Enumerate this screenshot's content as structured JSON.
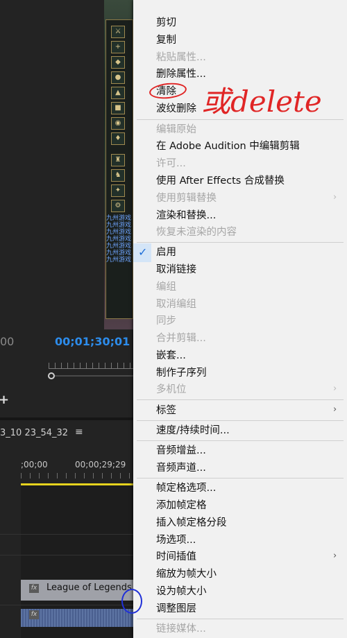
{
  "preview": {
    "timecode_left": "00",
    "timecode_current": "00;01;30;01",
    "game_texts": [
      "九州游戏",
      "九州游戏",
      "九州游戏",
      "九州游戏",
      "九州游戏",
      "九州游戏",
      "九州游戏"
    ]
  },
  "timeline": {
    "sequence_name": "3_10 23_54_32",
    "menu_icon": "≡",
    "time_start": ";00;00",
    "time_mark": "00;00;29;29",
    "clip_video_label": "League of Legends",
    "fx_label": "fx",
    "playhead_color": "#e6d31e",
    "clip_audio_color": "#5d74a3"
  },
  "context_menu": {
    "items": [
      {
        "label": "剪切",
        "enabled": true
      },
      {
        "label": "复制",
        "enabled": true
      },
      {
        "label": "粘贴属性...",
        "enabled": false
      },
      {
        "label": "删除属性...",
        "enabled": true
      },
      {
        "label": "清除",
        "enabled": true
      },
      {
        "label": "波纹删除",
        "enabled": true
      },
      {
        "label": "编辑原始",
        "enabled": false
      },
      {
        "label": "在 Adobe Audition 中编辑剪辑",
        "enabled": true
      },
      {
        "label": "许可...",
        "enabled": false
      },
      {
        "label": "使用 After Effects 合成替换",
        "enabled": true
      },
      {
        "label": "使用剪辑替换",
        "enabled": false,
        "submenu": true
      },
      {
        "label": "渲染和替换...",
        "enabled": true
      },
      {
        "label": "恢复未渲染的内容",
        "enabled": false
      },
      {
        "label": "启用",
        "enabled": true,
        "checked": true
      },
      {
        "label": "取消链接",
        "enabled": true
      },
      {
        "label": "编组",
        "enabled": false
      },
      {
        "label": "取消编组",
        "enabled": false
      },
      {
        "label": "同步",
        "enabled": false
      },
      {
        "label": "合并剪辑...",
        "enabled": false
      },
      {
        "label": "嵌套...",
        "enabled": true
      },
      {
        "label": "制作子序列",
        "enabled": true
      },
      {
        "label": "多机位",
        "enabled": false,
        "submenu": true
      },
      {
        "label": "标签",
        "enabled": true,
        "submenu": true
      },
      {
        "label": "速度/持续时间...",
        "enabled": true
      },
      {
        "label": "音频增益...",
        "enabled": true
      },
      {
        "label": "音频声道...",
        "enabled": true
      },
      {
        "label": "帧定格选项...",
        "enabled": true
      },
      {
        "label": "添加帧定格",
        "enabled": true
      },
      {
        "label": "插入帧定格分段",
        "enabled": true
      },
      {
        "label": "场选项...",
        "enabled": true
      },
      {
        "label": "时间插值",
        "enabled": true,
        "submenu": true
      },
      {
        "label": "缩放为帧大小",
        "enabled": true
      },
      {
        "label": "设为帧大小",
        "enabled": true
      },
      {
        "label": "调整图层",
        "enabled": true
      },
      {
        "label": "链接媒体...",
        "enabled": false
      }
    ],
    "check_glyph": "✓",
    "submenu_glyph": "›",
    "accent_color": "#1e6fd8"
  },
  "annotation": {
    "text": "或delete",
    "color": "#e02525"
  }
}
